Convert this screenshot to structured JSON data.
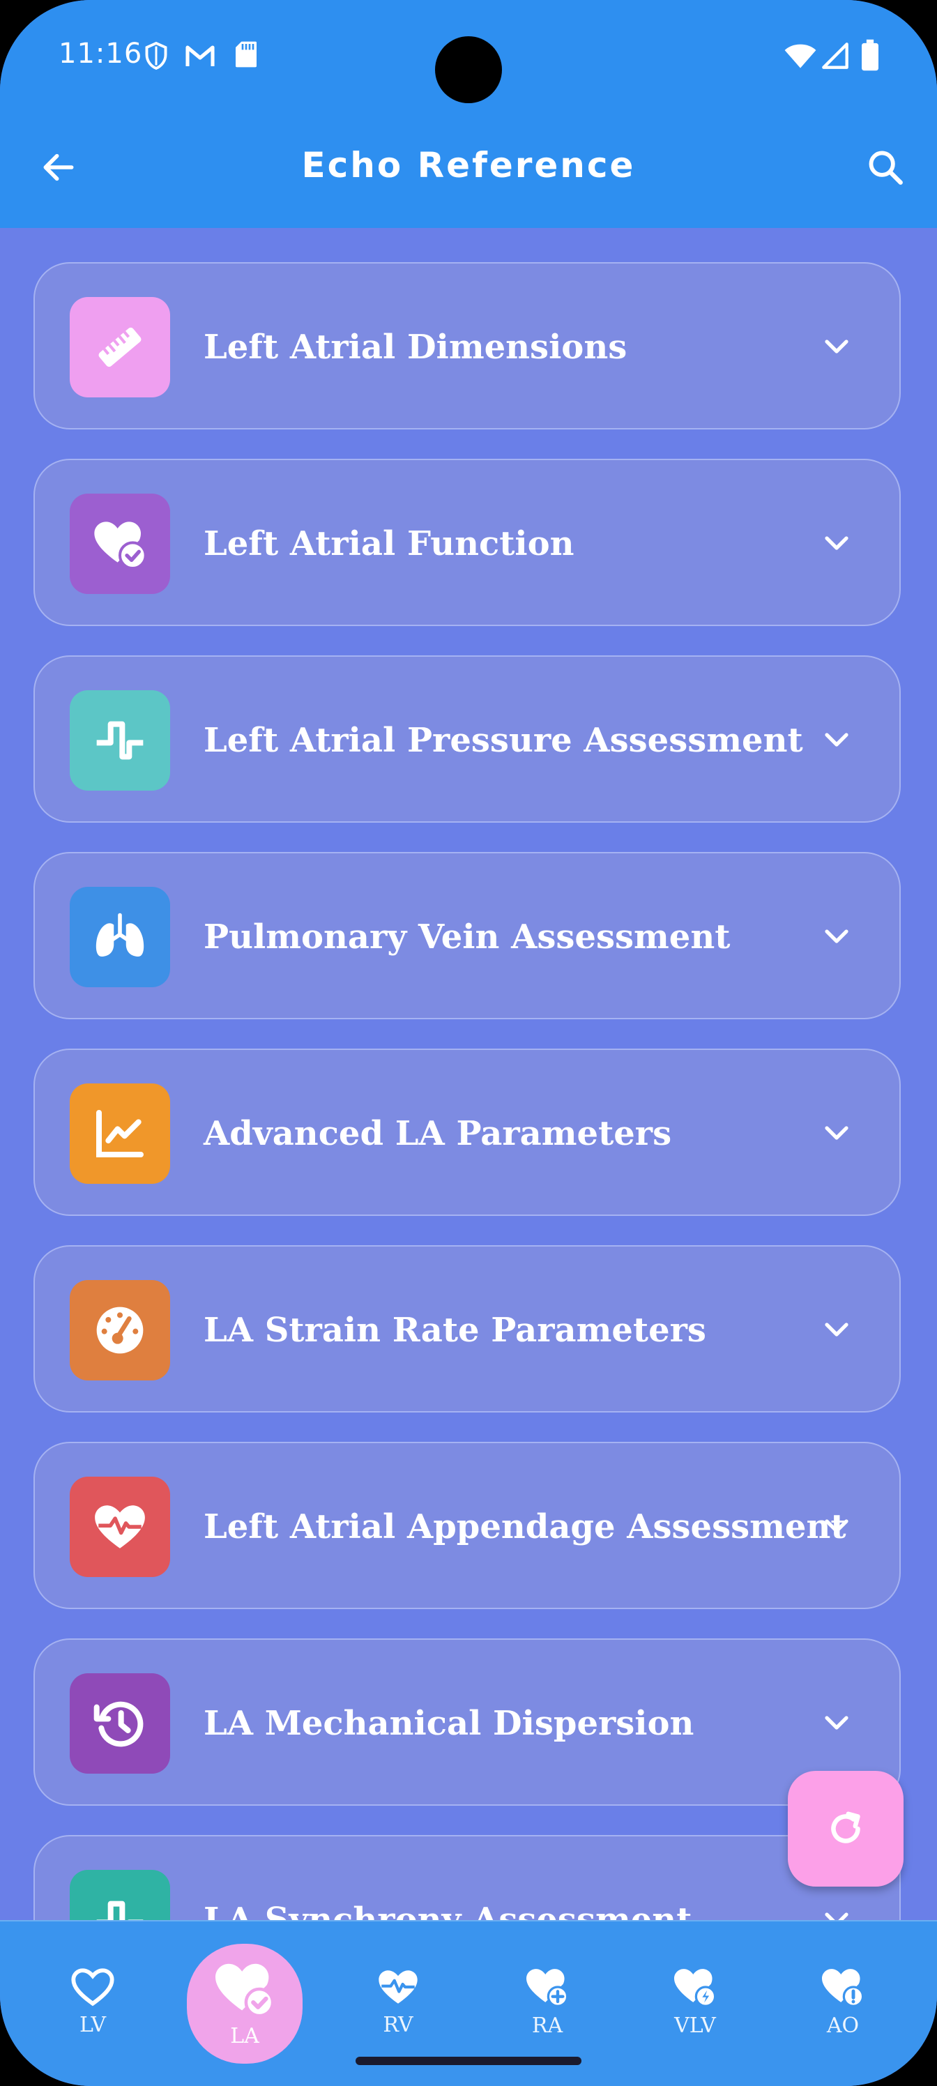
{
  "status": {
    "time": "11:16"
  },
  "header": {
    "title": "Echo Reference"
  },
  "sections": [
    {
      "label": "Left Atrial Dimensions",
      "icon": "ruler-icon",
      "color": "#ef9ff0"
    },
    {
      "label": "Left Atrial Function",
      "icon": "heart-check-icon",
      "color": "#9c5fd0"
    },
    {
      "label": "Left Atrial Pressure Assessment",
      "icon": "square-wave-icon",
      "color": "#5cc6c6"
    },
    {
      "label": "Pulmonary Vein Assessment",
      "icon": "lungs-icon",
      "color": "#3e90e6"
    },
    {
      "label": "Advanced LA Parameters",
      "icon": "line-chart-icon",
      "color": "#f0972a"
    },
    {
      "label": "LA Strain Rate Parameters",
      "icon": "gauge-icon",
      "color": "#df7f3f"
    },
    {
      "label": "Left Atrial Appendage Assessment",
      "icon": "heart-pulse-icon",
      "color": "#e0565b"
    },
    {
      "label": "LA Mechanical Dispersion",
      "icon": "history-icon",
      "color": "#8f4ab8"
    },
    {
      "label": "LA Synchrony Assessment",
      "icon": "square-wave-icon",
      "color": "#2fb3a4"
    }
  ],
  "nav": [
    {
      "label": "LV",
      "icon": "heart-outline-icon",
      "active": false
    },
    {
      "label": "LA",
      "icon": "heart-check-icon",
      "active": true
    },
    {
      "label": "RV",
      "icon": "heart-pulse-icon",
      "active": false
    },
    {
      "label": "RA",
      "icon": "heart-plus-icon",
      "active": false
    },
    {
      "label": "VLV",
      "icon": "heart-bolt-icon",
      "active": false
    },
    {
      "label": "AO",
      "icon": "heart-alert-icon",
      "active": false
    }
  ]
}
